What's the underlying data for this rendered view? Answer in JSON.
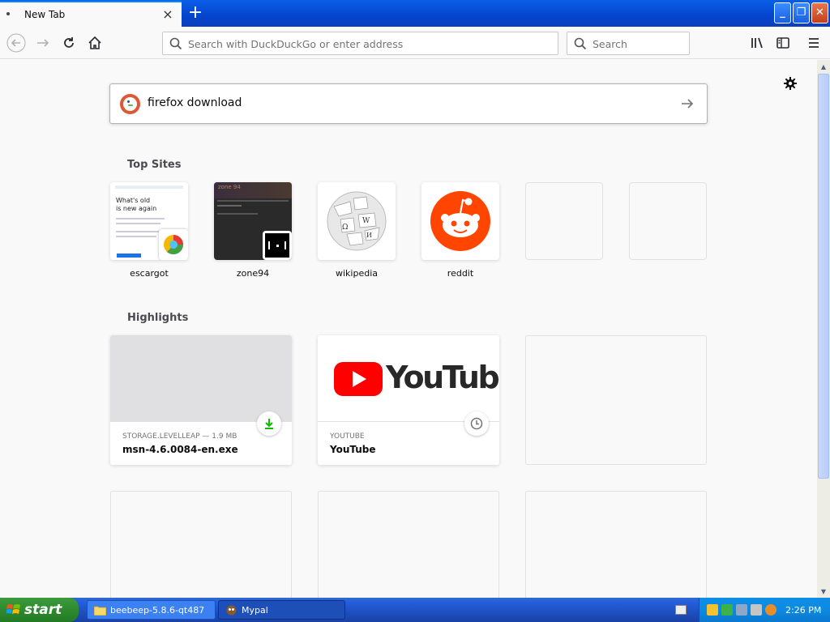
{
  "tab": {
    "title": "New Tab",
    "close": "×",
    "new_tab": "+"
  },
  "window": {
    "minimize": "_",
    "maximize": "❐",
    "close": "✕"
  },
  "toolbar": {
    "url_placeholder": "Search with DuckDuckGo or enter address",
    "search_placeholder": "Search"
  },
  "newtab": {
    "search_query": "firefox download",
    "top_sites_heading": "Top Sites",
    "top_sites": [
      {
        "label": "escargot"
      },
      {
        "label": "zone94"
      },
      {
        "label": "wikipedia"
      },
      {
        "label": "reddit"
      },
      {
        "label": ""
      },
      {
        "label": ""
      }
    ],
    "escargot_preview": {
      "line1": "What's old",
      "line2": "is new again"
    },
    "zone94_preview": {
      "text": "zone 94"
    },
    "highlights_heading": "Highlights",
    "highlights": [
      {
        "source": "STORAGE.LEVELLEAP — 1.9 MB",
        "title": "msn-4.6.0084-en.exe",
        "badge": "download-icon"
      },
      {
        "source": "YOUTUBE",
        "title": "YouTube",
        "badge": "clock-icon"
      }
    ],
    "youtube_wordmark": "YouTube"
  },
  "taskbar": {
    "start_label": "start",
    "tasks": [
      {
        "label": "beebeep-5.8.6-qt487"
      },
      {
        "label": "Mypal"
      }
    ],
    "clock": "2:26 PM"
  },
  "colors": {
    "accent": "#0a84ff",
    "ddg_orange": "#de5833",
    "reddit_orange": "#ff4500",
    "youtube_red": "#ff0000",
    "download_green": "#12bc00",
    "xp_taskbar": "#245edb",
    "xp_start_green": "#3c9a3c"
  }
}
